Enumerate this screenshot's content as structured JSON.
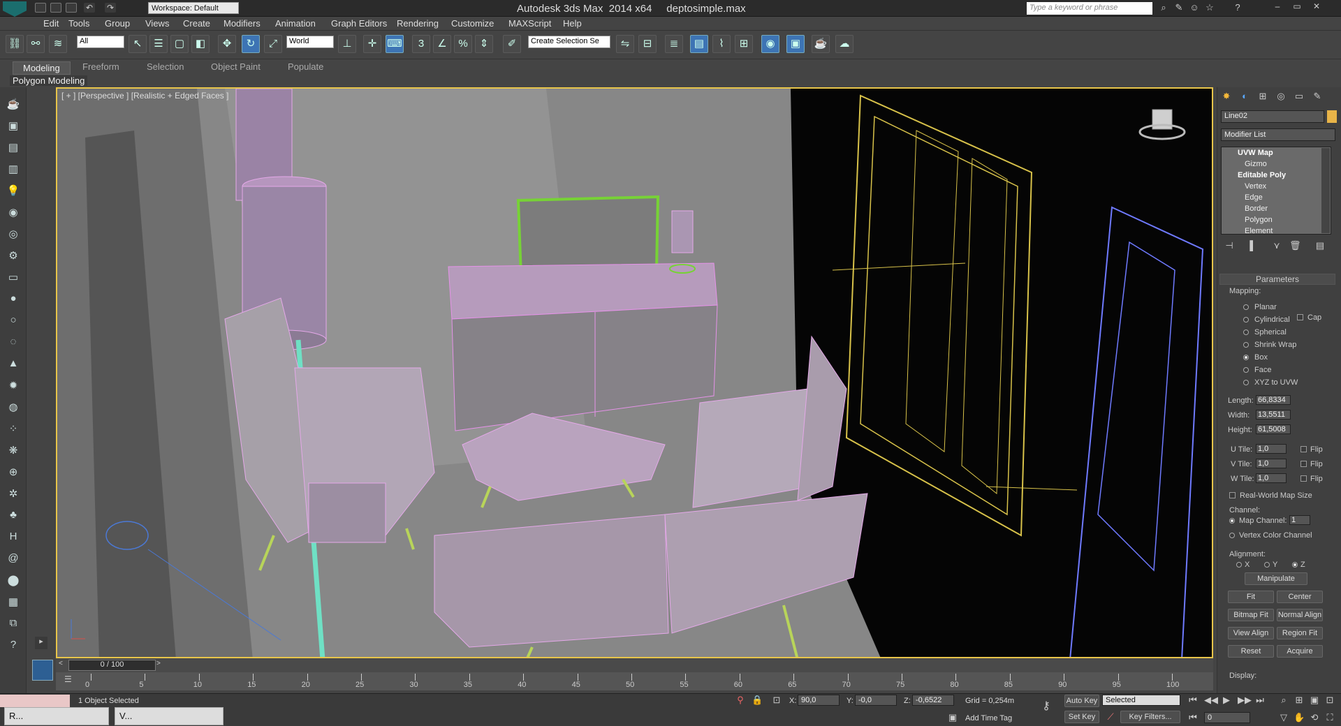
{
  "title": "Autodesk 3ds Max  2014 x64     deptosimple.max",
  "workspace": "Workspace: Default",
  "search_placeholder": "Type a keyword or phrase",
  "menus": [
    "Edit",
    "Tools",
    "Group",
    "Views",
    "Create",
    "Modifiers",
    "Animation",
    "Graph Editors",
    "Rendering",
    "Customize",
    "MAXScript",
    "Help"
  ],
  "toolbar": {
    "filter": "All",
    "coord": "World",
    "selection_set": "Create Selection Se",
    "snap_labels": [
      "3",
      "%"
    ]
  },
  "ribbon": {
    "tabs": [
      "Modeling",
      "Freeform",
      "Selection",
      "Object Paint",
      "Populate"
    ],
    "active": "Modeling",
    "panel": "Polygon Modeling"
  },
  "viewport": {
    "label": "[ + ] [Perspective ] [Realistic + Edged Faces ]",
    "accent": "#e8c54a"
  },
  "command_panel": {
    "object_name": "Line02",
    "modifier_list": "Modifier List",
    "stack": [
      {
        "label": "UVW Map",
        "bold": true
      },
      {
        "label": "Gizmo",
        "bold": false
      },
      {
        "label": "Editable Poly",
        "bold": true
      },
      {
        "label": "Vertex",
        "bold": false
      },
      {
        "label": "Edge",
        "bold": false
      },
      {
        "label": "Border",
        "bold": false
      },
      {
        "label": "Polygon",
        "bold": false
      },
      {
        "label": "Element",
        "bold": false
      }
    ],
    "rollout": "Parameters",
    "mapping_label": "Mapping:",
    "mapping": [
      "Planar",
      "Cylindrical",
      "Spherical",
      "Shrink Wrap",
      "Box",
      "Face",
      "XYZ to UVW"
    ],
    "mapping_selected": "Box",
    "cap_label": "Cap",
    "length_label": "Length:",
    "length": "66,8334",
    "width_label": "Width:",
    "width": "13,5511",
    "height_label": "Height:",
    "height": "61,5008",
    "utile_label": "U Tile:",
    "utile": "1,0",
    "vtile_label": "V Tile:",
    "vtile": "1,0",
    "wtile_label": "W Tile:",
    "wtile": "1,0",
    "flip_label": "Flip",
    "realworld": "Real-World Map Size",
    "channel_label": "Channel:",
    "map_channel_label": "Map Channel:",
    "map_channel": "1",
    "vertex_color": "Vertex Color Channel",
    "alignment_label": "Alignment:",
    "axes": [
      "X",
      "Y",
      "Z"
    ],
    "axis_selected": "Z",
    "manipulate": "Manipulate",
    "buttons": [
      "Fit",
      "Center",
      "Bitmap Fit",
      "Normal Align",
      "View Align",
      "Region Fit",
      "Reset",
      "Acquire"
    ],
    "display_label": "Display:"
  },
  "timeline": {
    "frame": "0 / 100",
    "ticks": [
      "0",
      "5",
      "10",
      "15",
      "20",
      "25",
      "30",
      "35",
      "40",
      "45",
      "50",
      "55",
      "60",
      "65",
      "70",
      "75",
      "80",
      "85",
      "90",
      "95",
      "100"
    ]
  },
  "status": {
    "selected": "1 Object Selected",
    "x": "90,0",
    "y": "-0,0",
    "z": "-0,6522",
    "grid": "Grid = 0,254m",
    "autokey": "Auto Key",
    "setkey": "Set Key",
    "selected_dropdown": "Selected",
    "keyfilters": "Key Filters...",
    "addtimetag": "Add Time Tag",
    "frame_field": "0"
  },
  "taskbar": {
    "items": [
      "R...",
      "V..."
    ]
  }
}
